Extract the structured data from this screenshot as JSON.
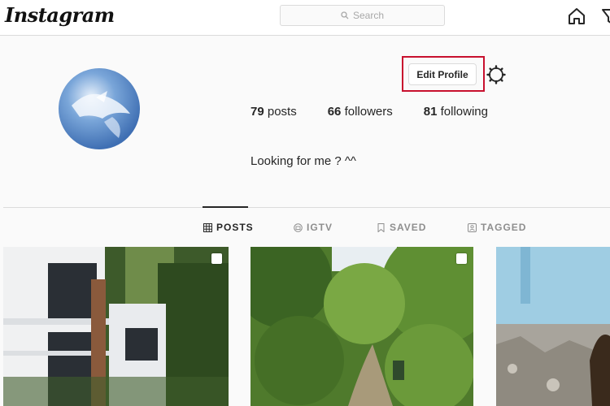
{
  "topbar": {
    "logo": "Instagram",
    "search_placeholder": "Search",
    "icons": [
      "home-icon",
      "explore-icon"
    ]
  },
  "profile": {
    "edit_button": "Edit Profile",
    "stats": {
      "posts_count": "79",
      "posts_label": " posts",
      "followers_count": "66",
      "followers_label": " followers",
      "following_count": "81",
      "following_label": " following"
    },
    "bio": "Looking for me ? ^^",
    "highlight_color": "#c8102e"
  },
  "tabs": [
    {
      "label": "POSTS",
      "icon": "grid-icon",
      "active": true
    },
    {
      "label": "IGTV",
      "icon": "igtv-icon",
      "active": false
    },
    {
      "label": "SAVED",
      "icon": "bookmark-icon",
      "active": false
    },
    {
      "label": "TAGGED",
      "icon": "tag-icon",
      "active": false
    }
  ],
  "colors": {
    "accent": "#262626",
    "muted": "#8e8e8e",
    "border": "#dbdbdb"
  }
}
